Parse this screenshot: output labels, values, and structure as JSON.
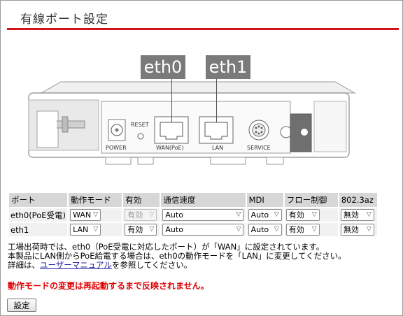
{
  "page": {
    "title": "有線ポート設定"
  },
  "device": {
    "tags": {
      "eth0": "eth0",
      "eth1": "eth1"
    },
    "labels": {
      "power": "POWER",
      "reset": "RESET",
      "wan": "WAN(PoE)",
      "lan": "LAN",
      "service": "SERVICE"
    }
  },
  "table": {
    "headers": [
      "ポート",
      "動作モード",
      "有効",
      "通信速度",
      "MDI",
      "フロー制御",
      "802.3az"
    ],
    "rows": [
      {
        "port": "eth0(PoE受電)",
        "mode": "WAN",
        "enabled": "有効",
        "speed": "Auto",
        "mdi": "Auto",
        "flow": "有効",
        "eee": "無効"
      },
      {
        "port": "eth1",
        "mode": "LAN",
        "enabled": "有効",
        "speed": "Auto",
        "mdi": "Auto",
        "flow": "有効",
        "eee": "無効"
      }
    ]
  },
  "notes": {
    "line1": "工場出荷時では、eth0（PoE受電に対応したポート）が「WAN」に設定されています。",
    "line2": "本製品にLAN側からPoE給電する場合は、eth0の動作モードを「LAN」に変更してください。",
    "line3_prefix": "詳細は、",
    "line3_link": "ユーザーマニュアル",
    "line3_suffix": "を参照してください。"
  },
  "warning": "動作モードの変更は再起動するまで反映されません。",
  "submit_label": "設定"
}
